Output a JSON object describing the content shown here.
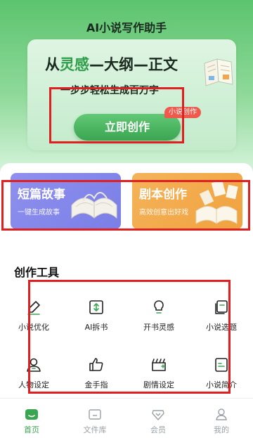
{
  "app": {
    "title": "AI小说写作助手"
  },
  "hero": {
    "headline_1": "从",
    "headline_2": "灵感",
    "headline_3": "—",
    "headline_4": "大纲",
    "headline_5": "—",
    "headline_6": "正文",
    "subtitle": "一步步轻松生成百万字",
    "button_label": "立即创作",
    "badge": "小说创作"
  },
  "feature_cards": [
    {
      "title": "短篇故事",
      "desc": "一键生成故事",
      "color": "#8a8cee"
    },
    {
      "title": "剧本创作",
      "desc": "高效创意出好戏",
      "color": "#f3ab4d"
    }
  ],
  "tools": {
    "section_title": "创作工具",
    "items": [
      {
        "label": "小说优化",
        "icon": "pen-icon"
      },
      {
        "label": "AI拆书",
        "icon": "split-book-icon"
      },
      {
        "label": "开书灵感",
        "icon": "lightbulb-icon"
      },
      {
        "label": "小说选题",
        "icon": "topic-card-icon"
      },
      {
        "label": "人物设定",
        "icon": "person-icon"
      },
      {
        "label": "金手指",
        "icon": "thumbs-up-icon"
      },
      {
        "label": "剧情设定",
        "icon": "clapperboard-icon"
      },
      {
        "label": "小说简介",
        "icon": "document-icon"
      }
    ]
  },
  "nav": {
    "items": [
      {
        "label": "首页",
        "icon": "home-icon",
        "active": true
      },
      {
        "label": "文件库",
        "icon": "folder-icon",
        "active": false
      },
      {
        "label": "会员",
        "icon": "vip-heart-icon",
        "active": false
      },
      {
        "label": "我的",
        "icon": "profile-icon",
        "active": false
      }
    ]
  },
  "colors": {
    "accent": "#3aa551",
    "highlight": "#e02020"
  }
}
